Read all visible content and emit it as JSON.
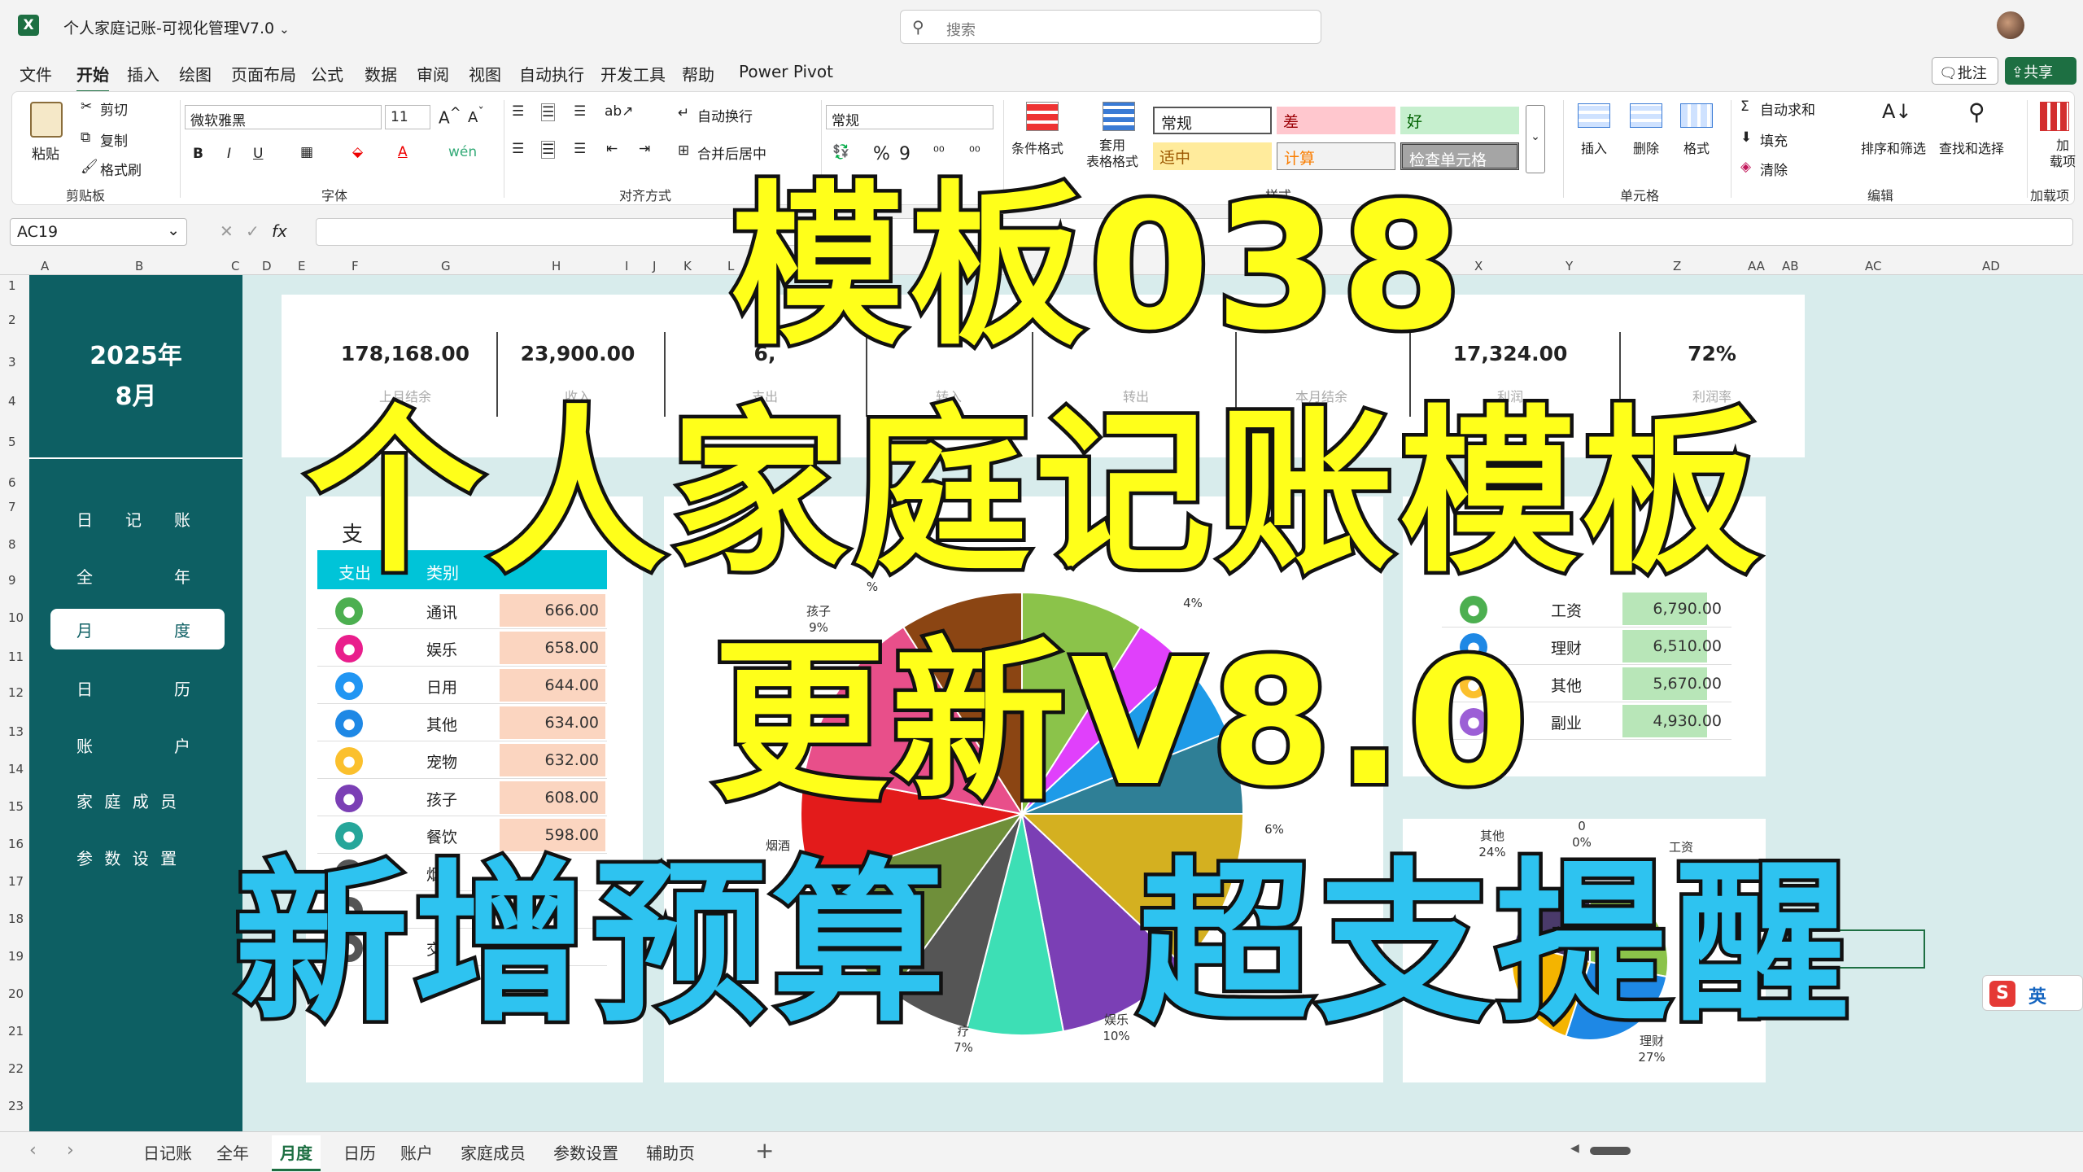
{
  "titlebar": {
    "file_title": "个人家庭记账-可视化管理V7.0",
    "search_placeholder": "搜索"
  },
  "menu": [
    "文件",
    "开始",
    "插入",
    "绘图",
    "页面布局",
    "公式",
    "数据",
    "审阅",
    "视图",
    "自动执行",
    "开发工具",
    "帮助",
    "Power Pivot"
  ],
  "menu_active": "开始",
  "menu_right": {
    "comment": "批注",
    "share": "共享"
  },
  "ribbon": {
    "clipboard": {
      "paste": "粘贴",
      "cut": "剪切",
      "copy": "复制",
      "format_painter": "格式刷",
      "label": "剪贴板"
    },
    "font": {
      "name": "微软雅黑",
      "size": "11",
      "label": "字体"
    },
    "alignment": {
      "wrap": "自动换行",
      "merge": "合并后居中",
      "label": "对齐方式"
    },
    "number": {
      "format": "常规"
    },
    "styles": {
      "conditional": "条件格式",
      "table_format": "套用\n表格格式",
      "cells": [
        "常规",
        "差",
        "好",
        "适中",
        "计算",
        "检查单元格"
      ],
      "label": "样式"
    },
    "cells_group": {
      "insert": "插入",
      "delete": "删除",
      "format": "格式",
      "label": "单元格"
    },
    "editing": {
      "autosum": "自动求和",
      "fill": "填充",
      "clear": "清除",
      "sort": "排序和筛选",
      "find": "查找和选择",
      "label": "编辑"
    },
    "addins": {
      "label": "加载项",
      "btn": "加\n载项"
    }
  },
  "formula_bar": {
    "name_box": "AC19",
    "fx": "fx"
  },
  "columns": [
    "A",
    "B",
    "C",
    "D",
    "E",
    "F",
    "G",
    "H",
    "I",
    "J",
    "K",
    "L",
    "W",
    "X",
    "Y",
    "Z",
    "AA",
    "AB",
    "AC",
    "AD"
  ],
  "rows": [
    "1",
    "2",
    "3",
    "4",
    "5",
    "6",
    "7",
    "8",
    "9",
    "10",
    "11",
    "12",
    "13",
    "14",
    "15",
    "16",
    "17",
    "18",
    "19",
    "20",
    "21",
    "22",
    "23"
  ],
  "sidebar": {
    "year": "2025年",
    "month": "8月",
    "items": [
      "日　记　账",
      "全　　　年",
      "月　　　度",
      "日　　　历",
      "账　　　户",
      "家 庭 成 员",
      "参 数 设 置"
    ],
    "active_index": 2
  },
  "kpis": [
    {
      "value": "178,168.00",
      "label": "上月结余"
    },
    {
      "value": "23,900.00",
      "label": "收入"
    },
    {
      "value": "6,",
      "label": "支出"
    },
    {
      "value": "",
      "label": "转入"
    },
    {
      "value": "",
      "label": "转出"
    },
    {
      "value": "",
      "label": "本月结余"
    },
    {
      "value": "17,324.00",
      "label": "利润"
    },
    {
      "value": "72%",
      "label": "利润率"
    }
  ],
  "expense_table": {
    "title": "支",
    "header": [
      "支出",
      "类别"
    ],
    "rows": [
      {
        "name": "通讯",
        "amount": "666.00",
        "icon": "phone-icon",
        "color": "#4caf50"
      },
      {
        "name": "娱乐",
        "amount": "658.00",
        "icon": "cart-icon",
        "color": "#e91e8c"
      },
      {
        "name": "日用",
        "amount": "644.00",
        "icon": "bag-icon",
        "color": "#2196f3"
      },
      {
        "name": "其他",
        "amount": "634.00",
        "icon": "car-icon",
        "color": "#1e88e5"
      },
      {
        "name": "宠物",
        "amount": "632.00",
        "icon": "pet-icon",
        "color": "#fbc02d"
      },
      {
        "name": "孩子",
        "amount": "608.00",
        "icon": "child-icon",
        "color": "#7b3fb5"
      },
      {
        "name": "餐饮",
        "amount": "598.00",
        "icon": "food-icon",
        "color": "#26a69a"
      },
      {
        "name": "烟",
        "amount": "",
        "icon": "misc-icon",
        "color": "#555555"
      },
      {
        "name": "美",
        "amount": "",
        "icon": "misc-icon",
        "color": "#555555"
      },
      {
        "name": "交",
        "amount": "",
        "icon": "misc-icon",
        "color": "#555555"
      }
    ]
  },
  "income_table": {
    "rows": [
      {
        "name": "工资",
        "amount": "6,790.00",
        "icon": "wallet-icon",
        "color": "#4caf50"
      },
      {
        "name": "理财",
        "amount": "6,510.00",
        "icon": "chart-icon",
        "color": "#1e88e5"
      },
      {
        "name": "其他",
        "amount": "5,670.00",
        "icon": "box-icon",
        "color": "#fbc02d"
      },
      {
        "name": "副业",
        "amount": "4,930.00",
        "icon": "gear-icon",
        "color": "#9c5fd6"
      }
    ]
  },
  "chart_data": [
    {
      "type": "pie",
      "title": "",
      "labels": [
        "孩子",
        "烟酒",
        "娱乐",
        "医疗"
      ],
      "slices": [
        {
          "label": "",
          "value": 9,
          "color": "#8bc34a"
        },
        {
          "label": "",
          "value": 4,
          "color": "#e040fb"
        },
        {
          "label": "",
          "value": 6,
          "color": "#1e9be8"
        },
        {
          "label": "",
          "value": 6,
          "color": "#2f7f96"
        },
        {
          "label": "",
          "value": 12,
          "color": "#d4b020"
        },
        {
          "label": "娱乐",
          "value": 10,
          "color": "#7b3fb5"
        },
        {
          "label": "医疗",
          "value": 7,
          "color": "#3ddfb5"
        },
        {
          "label": "",
          "value": 6,
          "color": "#555555"
        },
        {
          "label": "烟酒",
          "value": 10,
          "color": "#6f8f3a"
        },
        {
          "label": "",
          "value": 8,
          "color": "#e31b1b"
        },
        {
          "label": "",
          "value": 13,
          "color": "#e84f8a"
        },
        {
          "label": "孩子",
          "value": 9,
          "color": "#8b4513"
        }
      ],
      "visible_labels": [
        {
          "text": "孩子",
          "pct": "9%"
        },
        {
          "text": "",
          "pct": "4%"
        },
        {
          "text": "",
          "pct": "6%"
        },
        {
          "text": "烟酒",
          "pct": ""
        },
        {
          "text": "娱乐",
          "pct": "10%"
        },
        {
          "text": "疗",
          "pct": "7%"
        },
        {
          "text": "",
          "pct": "%"
        }
      ]
    },
    {
      "type": "pie",
      "title": "",
      "slices": [
        {
          "label": "工资",
          "value": 28,
          "color": "#8bc34a"
        },
        {
          "label": "理财",
          "value": 27,
          "color": "#1e88e5"
        },
        {
          "label": "其他",
          "value": 24,
          "color": "#f4b400"
        },
        {
          "label": "副业",
          "value": 21,
          "color": "#4a3a6a"
        }
      ],
      "visible_labels": [
        {
          "text": "其他",
          "pct": "24%"
        },
        {
          "text": "工资",
          "pct": ""
        },
        {
          "text": "理财",
          "pct": "27%"
        },
        {
          "text": "0",
          "pct": "0%"
        }
      ]
    }
  ],
  "overlay": {
    "line1": "模板038",
    "line2": "个人家庭记账模板",
    "line3": "更新V8.0",
    "line4a": "新增预算",
    "line4b": "超支提醒"
  },
  "ime": {
    "label": "英"
  },
  "tabs": [
    "日记账",
    "全年",
    "月度",
    "日历",
    "账户",
    "家庭成员",
    "参数设置",
    "辅助页"
  ],
  "active_tab": "月度"
}
